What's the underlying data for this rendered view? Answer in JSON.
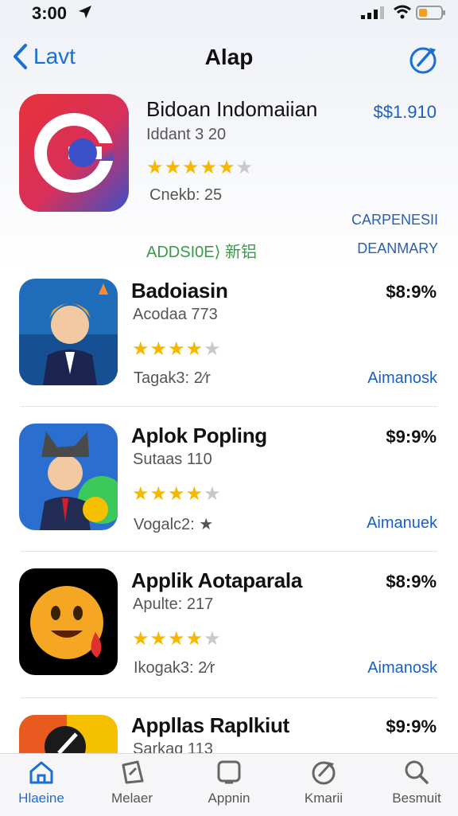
{
  "status_bar": {
    "time": "3:00"
  },
  "nav": {
    "back_label": "Lavt",
    "title": "Alap"
  },
  "featured": {
    "name": "Bidoan Indomaiian",
    "subtitle": "Iddant 3 20",
    "rating": 4.5,
    "meta": "Cnekb: 25",
    "price": "$$1.910",
    "link_top": "CARPENESII",
    "link_bottom": "DEANMARY",
    "adds_label": "ADDSI0E⟩ 新铝"
  },
  "apps": [
    {
      "name": "Badoiasin",
      "subtitle": "Acodaa 773",
      "rating": 4.5,
      "meta": "Tagak3: 2⁄r",
      "price": "$8:9%",
      "action": "Aimanosk"
    },
    {
      "name": "Aplok Popling",
      "subtitle": "Sutaas 110",
      "rating": 4.5,
      "meta": "Vogalc2: ★",
      "price": "$9:9%",
      "action": "Aimanuek"
    },
    {
      "name": "Applik Aotaparala",
      "subtitle": "Apulte: 217",
      "rating": 4.5,
      "meta": "Ikogak3: 2⁄r",
      "price": "$8:9%",
      "action": "Aimanosk"
    },
    {
      "name": "Appllas Raplkiut",
      "subtitle": "Sarkag 113",
      "price": "$9:9%"
    }
  ],
  "tabs": [
    {
      "label": "Hlaeine",
      "icon": "home-icon",
      "active": true
    },
    {
      "label": "Melaer",
      "icon": "games-icon",
      "active": false
    },
    {
      "label": "Appnin",
      "icon": "apps-icon",
      "active": false
    },
    {
      "label": "Kmarii",
      "icon": "arcade-icon",
      "active": false
    },
    {
      "label": "Besmuit",
      "icon": "search-icon",
      "active": false
    }
  ],
  "colors": {
    "accent": "#1a6fd6",
    "star": "#f5b800",
    "green": "#3a9a4a"
  }
}
